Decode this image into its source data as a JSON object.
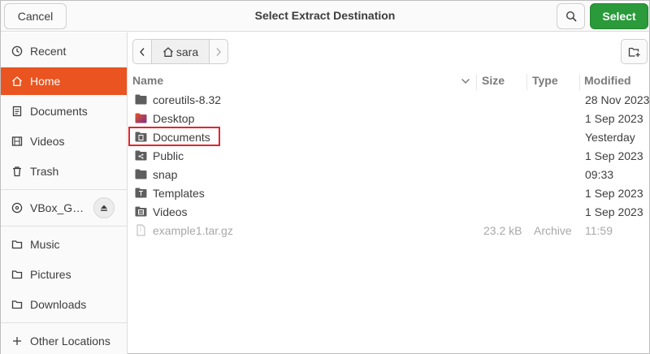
{
  "header": {
    "cancel_label": "Cancel",
    "title": "Select Extract Destination",
    "select_label": "Select"
  },
  "sidebar": {
    "items": [
      {
        "label": "Recent",
        "icon": "clock-icon"
      },
      {
        "label": "Home",
        "icon": "home-icon",
        "active": true
      },
      {
        "label": "Documents",
        "icon": "document-icon"
      },
      {
        "label": "Videos",
        "icon": "film-icon"
      },
      {
        "label": "Trash",
        "icon": "trash-icon"
      },
      {
        "label": "VBox_G…",
        "icon": "disc-icon"
      },
      {
        "label": "Music",
        "icon": "folder-icon"
      },
      {
        "label": "Pictures",
        "icon": "folder-icon"
      },
      {
        "label": "Downloads",
        "icon": "folder-icon"
      },
      {
        "label": "Other Locations",
        "icon": "plus-icon"
      }
    ]
  },
  "pathbar": {
    "current": "sara"
  },
  "table": {
    "columns": [
      "Name",
      "Size",
      "Type",
      "Modified"
    ],
    "rows": [
      {
        "name": "coreutils-8.32",
        "size": "",
        "type": "",
        "modified": "28 Nov 2023",
        "icon": "folder-icon"
      },
      {
        "name": "Desktop",
        "size": "",
        "type": "",
        "modified": "1 Sep 2023",
        "icon": "desktop-folder-icon"
      },
      {
        "name": "Documents",
        "size": "",
        "type": "",
        "modified": "Yesterday",
        "icon": "documents-folder-icon"
      },
      {
        "name": "Public",
        "size": "",
        "type": "",
        "modified": "1 Sep 2023",
        "icon": "public-folder-icon"
      },
      {
        "name": "snap",
        "size": "",
        "type": "",
        "modified": "09:33",
        "icon": "folder-icon"
      },
      {
        "name": "Templates",
        "size": "",
        "type": "",
        "modified": "1 Sep 2023",
        "icon": "templates-folder-icon"
      },
      {
        "name": "Videos",
        "size": "",
        "type": "",
        "modified": "1 Sep 2023",
        "icon": "videos-folder-icon"
      },
      {
        "name": "example1.tar.gz",
        "size": "23.2 kB",
        "type": "Archive",
        "modified": "11:59",
        "icon": "archive-file-icon",
        "dim": true
      }
    ]
  },
  "colors": {
    "accent": "#e95420",
    "select_button": "#2a9a3a",
    "highlight_box": "#e0262f",
    "folder": "#5e5e5e"
  }
}
